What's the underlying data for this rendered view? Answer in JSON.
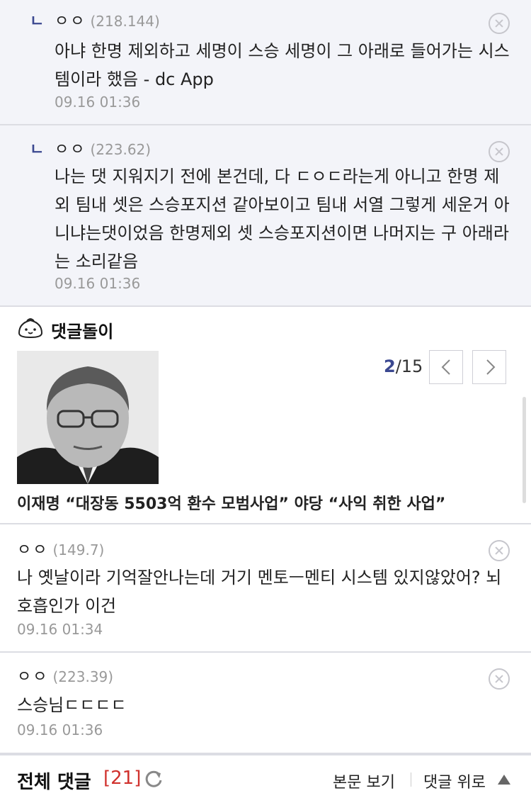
{
  "replies": [
    {
      "nick": "ㅇㅇ",
      "ip": "(218.144)",
      "text": "아냐 한명 제외하고 세명이 스승 세명이 그 아래로 들어가는 시스템이라 했음 - dc App",
      "date": "09.16 01:36"
    },
    {
      "nick": "ㅇㅇ",
      "ip": "(223.62)",
      "text": "나는 댓 지워지기 전에 본건데, 다 ㄷㅇㄷ라는게 아니고 한명 제외 팀내 셋은 스승포지션 같아보이고 팀내 서열 그렇게 세운거 아니냐는댓이었음 한명제외 셋 스승포지션이면 나머지는 구 아래라는 소리같음",
      "date": "09.16 01:36"
    }
  ],
  "reply_arrow": "ㄴ",
  "bot": {
    "title": "댓글돌이",
    "icon": "dumpling-mascot-icon",
    "page_current": "2",
    "page_total": "/15",
    "headline": "이재명 “대장동 5503억 환수 모범사업” 야당 “사익 취한 사업”"
  },
  "comments": [
    {
      "nick": "ㅇㅇ",
      "ip": "(149.7)",
      "text": "나 옛날이라 기억잘안나는데 거기 멘토ㅡ멘티 시스템 있지않았어? 뇌호흡인가 이건",
      "date": "09.16 01:34"
    },
    {
      "nick": "ㅇㅇ",
      "ip": "(223.39)",
      "text": "스승님ㄷㄷㄷㄷ",
      "date": "09.16 01:36"
    }
  ],
  "footer": {
    "title": "전체 댓글",
    "count": "[21]",
    "view_post": "본문 보기",
    "to_top": "댓글 위로"
  },
  "colors": {
    "accent": "#3b4890",
    "count_red": "#d0312d",
    "reply_bg": "#f3f4f9",
    "muted": "#999999"
  }
}
